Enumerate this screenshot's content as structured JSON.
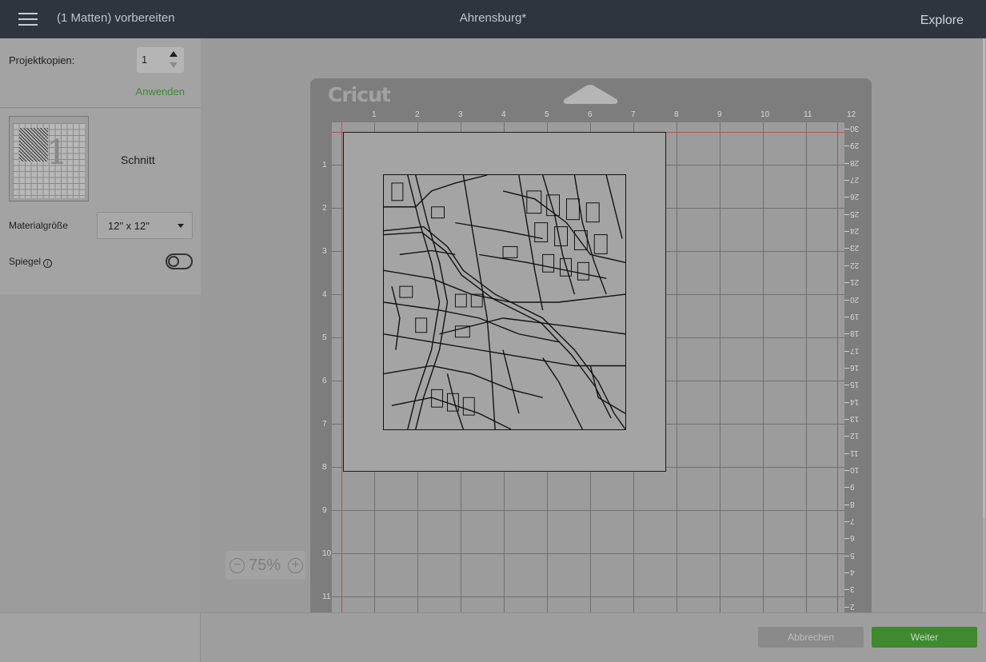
{
  "topbar": {
    "prep_title": "(1 Matten) vorbereiten",
    "project_title": "Ahrensburg*",
    "machine_label": "Explore"
  },
  "sidebar": {
    "copies_label": "Projektkopien:",
    "copies_value": "1",
    "apply_label": "Anwenden",
    "mat_number": "1",
    "cut_label": "Schnitt",
    "matsize_label": "Materialgröße",
    "matsize_value": "12\" x 12\"",
    "mirror_label": "Spiegel",
    "mirror_on": false
  },
  "mat": {
    "logo": "Cricut",
    "ruler_top": [
      "1",
      "2",
      "3",
      "4",
      "5",
      "6",
      "7",
      "8",
      "9",
      "10",
      "11",
      "12"
    ],
    "ruler_left": [
      "1",
      "2",
      "3",
      "4",
      "5",
      "6",
      "7",
      "8",
      "9",
      "10",
      "11"
    ],
    "ruler_right": [
      "30",
      "29",
      "28",
      "27",
      "26",
      "25",
      "24",
      "23",
      "22",
      "21",
      "20",
      "19",
      "18",
      "17",
      "16",
      "15",
      "14",
      "13",
      "12",
      "11",
      "10",
      "9",
      "8",
      "7",
      "6",
      "5",
      "4",
      "3",
      "2"
    ]
  },
  "zoom": {
    "value": "75%",
    "out": "−",
    "in": "+"
  },
  "footer": {
    "cancel_label": "Abbrechen",
    "next_label": "Weiter"
  },
  "colors": {
    "topbar": "#2e353c",
    "accent_green": "#3f8a2f",
    "overlay_gray": "#9a9a9a"
  }
}
